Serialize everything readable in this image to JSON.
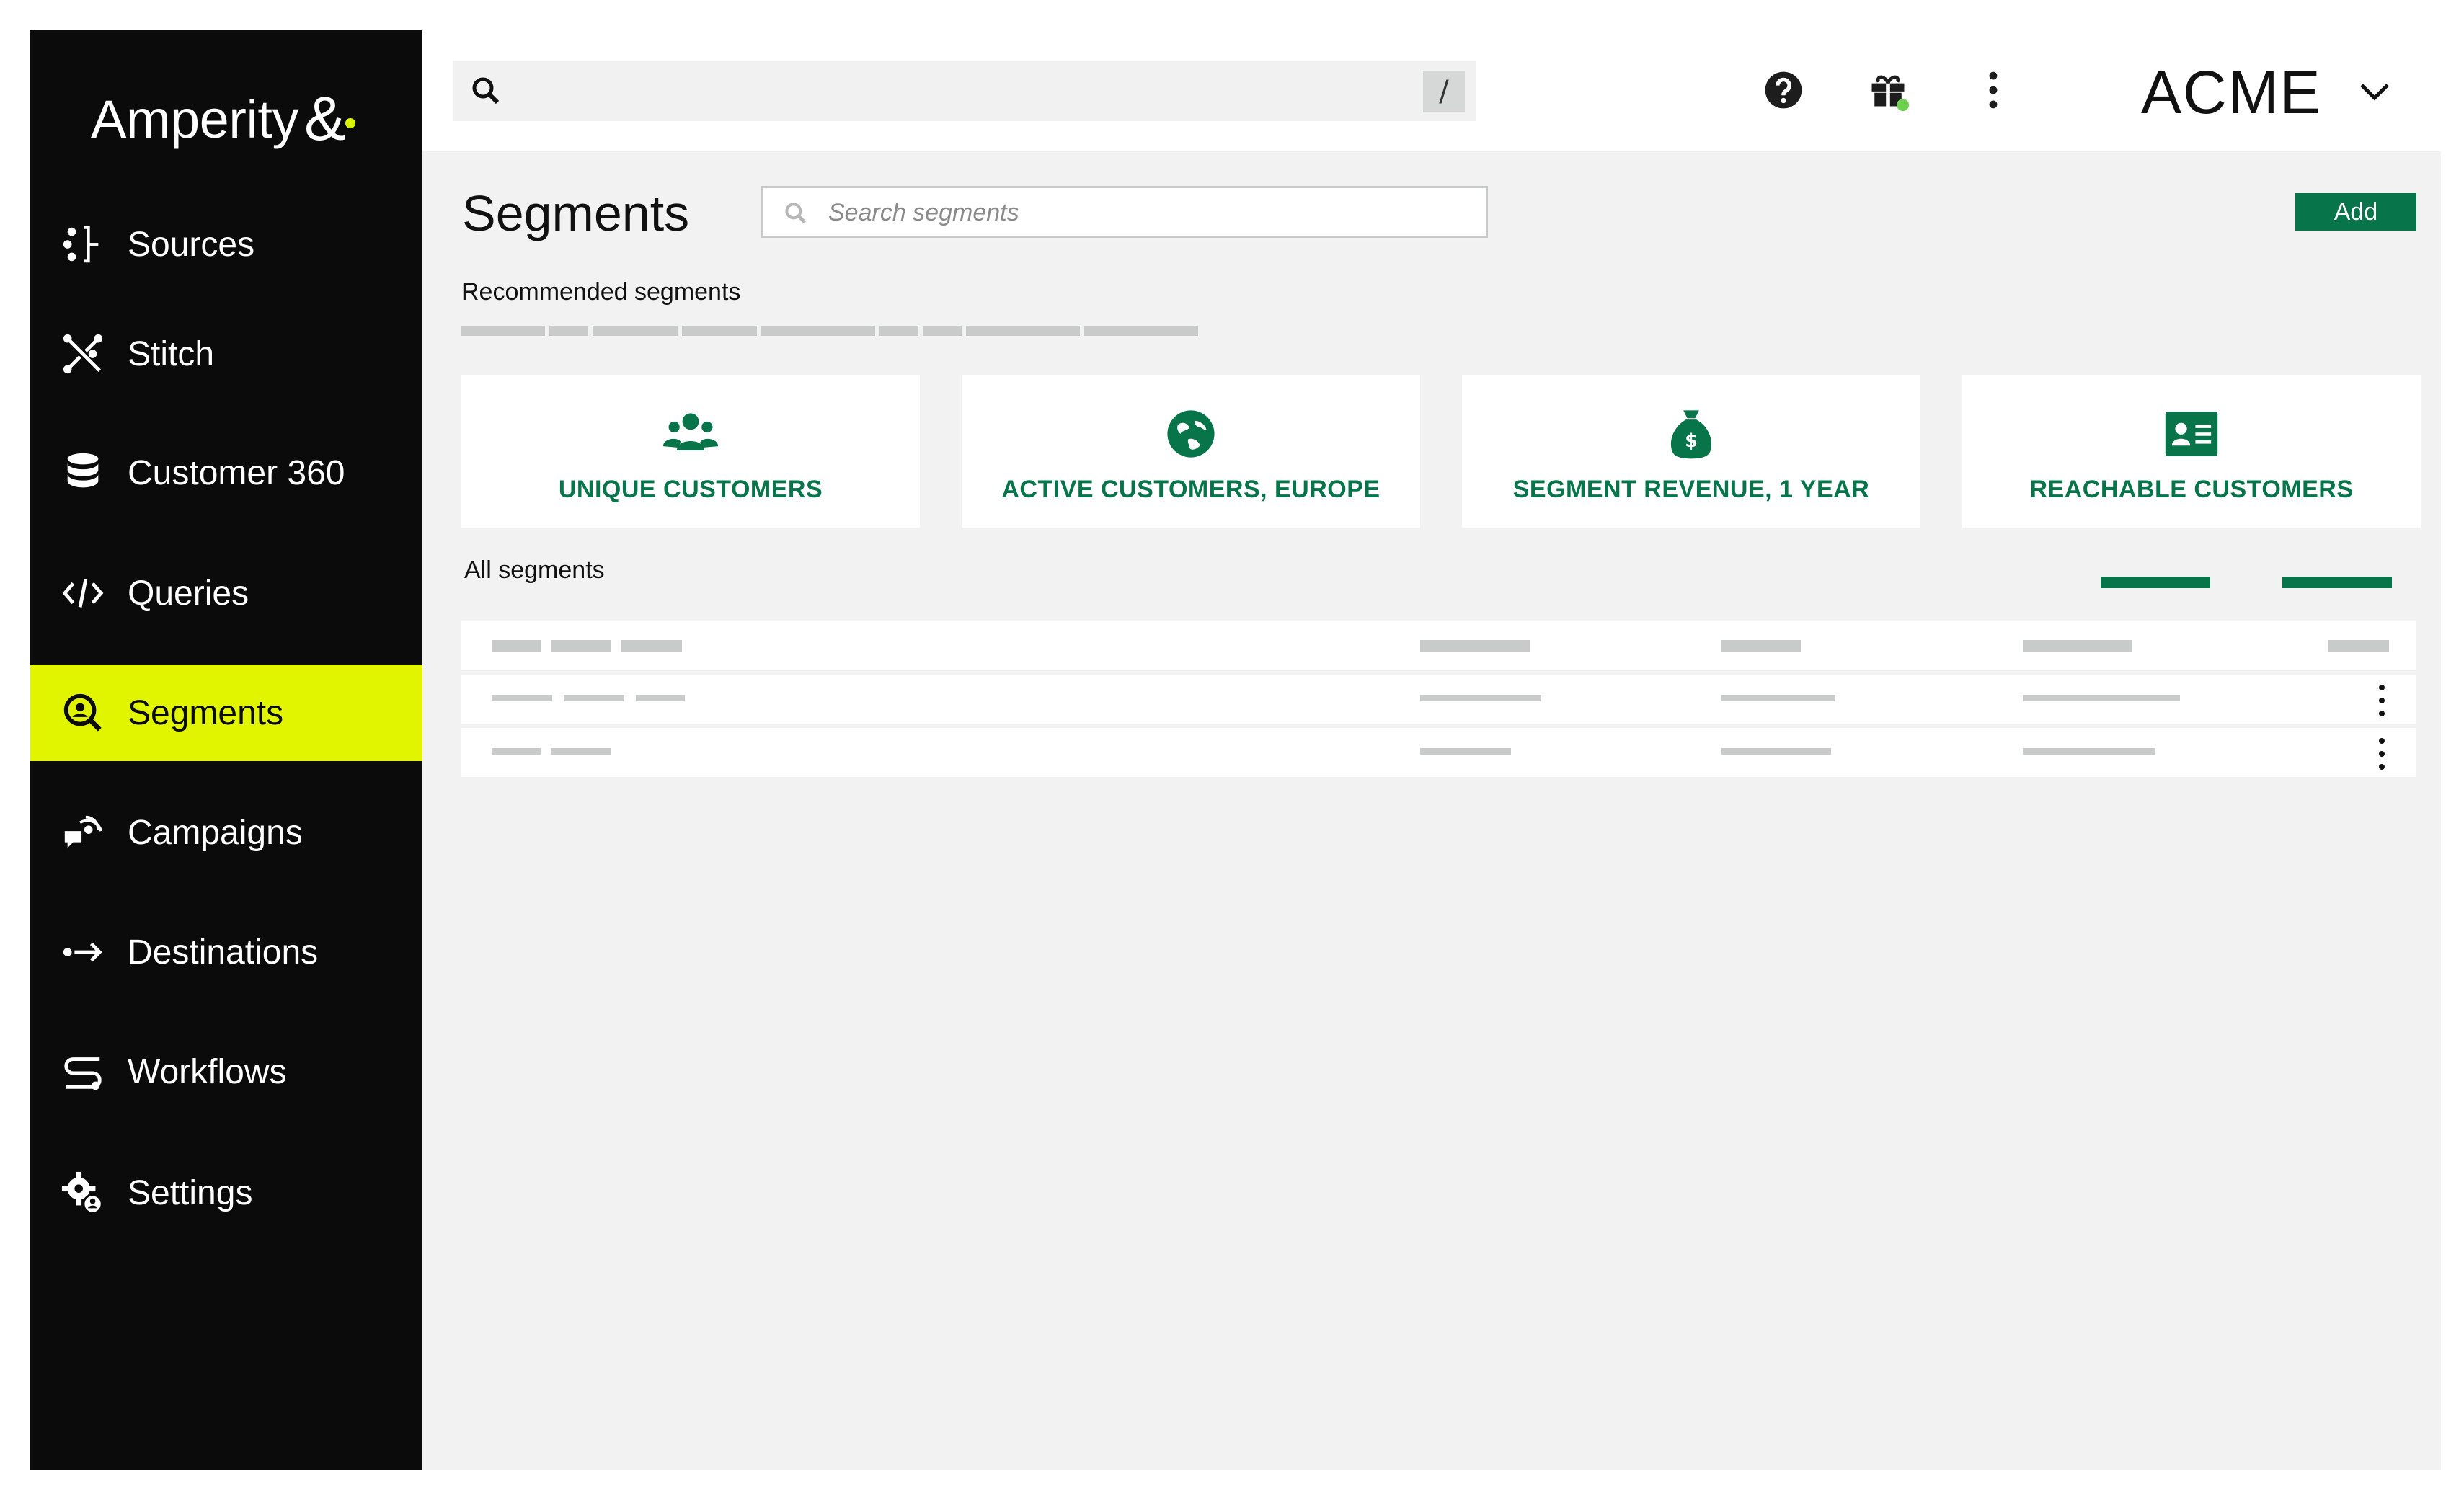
{
  "sidebar": {
    "logo_text": "Amperity",
    "logo_mark": "&",
    "items": [
      {
        "label": "Sources",
        "icon": "sources-icon",
        "active": false
      },
      {
        "label": "Stitch",
        "icon": "stitch-icon",
        "active": false
      },
      {
        "label": "Customer 360",
        "icon": "database-icon",
        "active": false
      },
      {
        "label": "Queries",
        "icon": "code-icon",
        "active": false
      },
      {
        "label": "Segments",
        "icon": "segment-search-icon",
        "active": true
      },
      {
        "label": "Campaigns",
        "icon": "campaigns-icon",
        "active": false
      },
      {
        "label": "Destinations",
        "icon": "destinations-arrow-icon",
        "active": false
      },
      {
        "label": "Workflows",
        "icon": "workflows-icon",
        "active": false
      },
      {
        "label": "Settings",
        "icon": "settings-gear-icon",
        "active": false
      }
    ]
  },
  "topbar": {
    "search_placeholder": "",
    "shortcut_key": "/",
    "icons": [
      "help-icon",
      "gift-icon",
      "more-vertical-icon"
    ],
    "brand": "ACME"
  },
  "main": {
    "title": "Segments",
    "search_placeholder": "Search segments",
    "add_label": "Add",
    "recommended_heading": "Recommended segments",
    "cards": [
      {
        "label": "UNIQUE CUSTOMERS",
        "icon": "users-group-icon"
      },
      {
        "label": "ACTIVE CUSTOMERS, EUROPE",
        "icon": "globe-icon"
      },
      {
        "label": "SEGMENT REVENUE, 1 YEAR",
        "icon": "money-bag-icon"
      },
      {
        "label": "REACHABLE CUSTOMERS",
        "icon": "contact-card-icon"
      }
    ],
    "all_heading": "All segments"
  },
  "colors": {
    "sidebar_bg": "#0b0b0b",
    "active_highlight": "#e2f500",
    "accent_green": "#07744a",
    "content_bg": "#f1f2f1",
    "notification_dot": "#6fcf4f"
  }
}
